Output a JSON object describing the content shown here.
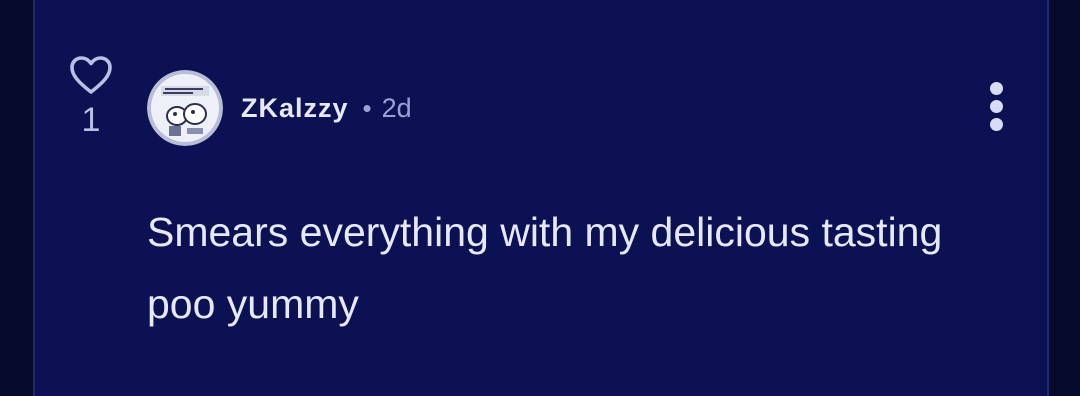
{
  "comment": {
    "like_count": "1",
    "author": "ZKalzzy",
    "separator": "•",
    "timestamp": "2d",
    "text": "Smears everything with my delicious tasting poo yummy",
    "icons": {
      "like": "heart-outline-icon",
      "more": "more-vertical-icon"
    }
  },
  "colors": {
    "background": "#0b1152",
    "outer_background": "#060b2c",
    "text": "#e6e8fb",
    "muted": "#9aa2d8"
  }
}
